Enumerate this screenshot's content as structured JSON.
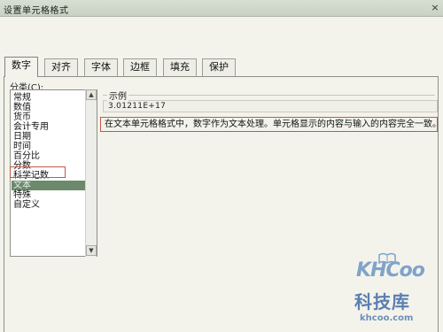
{
  "window": {
    "title": "设置单元格格式",
    "close_glyph": "×"
  },
  "tabs": [
    {
      "label": "数字",
      "active": true
    },
    {
      "label": "对齐",
      "active": false
    },
    {
      "label": "字体",
      "active": false
    },
    {
      "label": "边框",
      "active": false
    },
    {
      "label": "填充",
      "active": false
    },
    {
      "label": "保护",
      "active": false
    }
  ],
  "category": {
    "label": "分类(C):",
    "items": [
      "常规",
      "数值",
      "货币",
      "会计专用",
      "日期",
      "时间",
      "百分比",
      "分数",
      "科学记数",
      "文本",
      "特殊",
      "自定义"
    ],
    "selected": "文本"
  },
  "sample": {
    "label": "示例",
    "value": "3.01211E+17"
  },
  "description": "在文本单元格格式中，数字作为文本处理。单元格显示的内容与输入的内容完全一致。",
  "watermark": {
    "logo_text": "KHCoo",
    "name": "科技库",
    "domain": "khcoo.com"
  },
  "colors": {
    "selection": "#6b8a6c",
    "highlight_border": "#c15a45",
    "watermark": "#5a7fb0"
  }
}
